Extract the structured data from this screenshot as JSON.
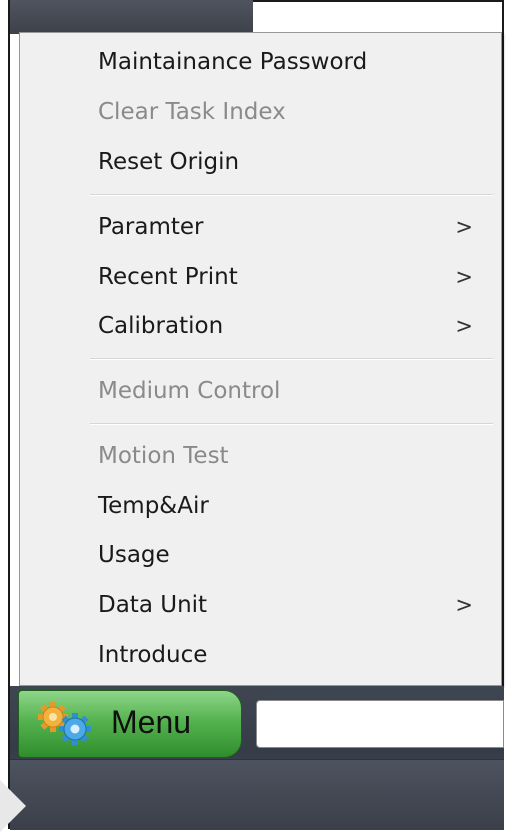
{
  "menu": {
    "items": [
      {
        "label": "Maintainance Password",
        "enabled": true,
        "submenu": false
      },
      {
        "label": "Clear Task Index",
        "enabled": false,
        "submenu": false
      },
      {
        "label": "Reset Origin",
        "enabled": true,
        "submenu": false
      },
      {
        "label": "Paramter",
        "enabled": true,
        "submenu": true
      },
      {
        "label": "Recent Print",
        "enabled": true,
        "submenu": true
      },
      {
        "label": "Calibration",
        "enabled": true,
        "submenu": true
      },
      {
        "label": "Medium Control",
        "enabled": false,
        "submenu": false
      },
      {
        "label": "Motion Test",
        "enabled": false,
        "submenu": false
      },
      {
        "label": "Temp&Air",
        "enabled": true,
        "submenu": false
      },
      {
        "label": "Usage",
        "enabled": true,
        "submenu": false
      },
      {
        "label": "Data Unit",
        "enabled": true,
        "submenu": true
      },
      {
        "label": "Introduce",
        "enabled": true,
        "submenu": false
      }
    ],
    "submenu_arrow": ">"
  },
  "taskbar": {
    "menu_button_label": "Menu",
    "menu_button_icon": "gears-icon",
    "input_value": ""
  },
  "colors": {
    "menu_background": "#f0f0f0",
    "disabled_text": "#8a8a8a",
    "menu_button_green": "#55b34f",
    "taskbar": "#3f4652"
  }
}
